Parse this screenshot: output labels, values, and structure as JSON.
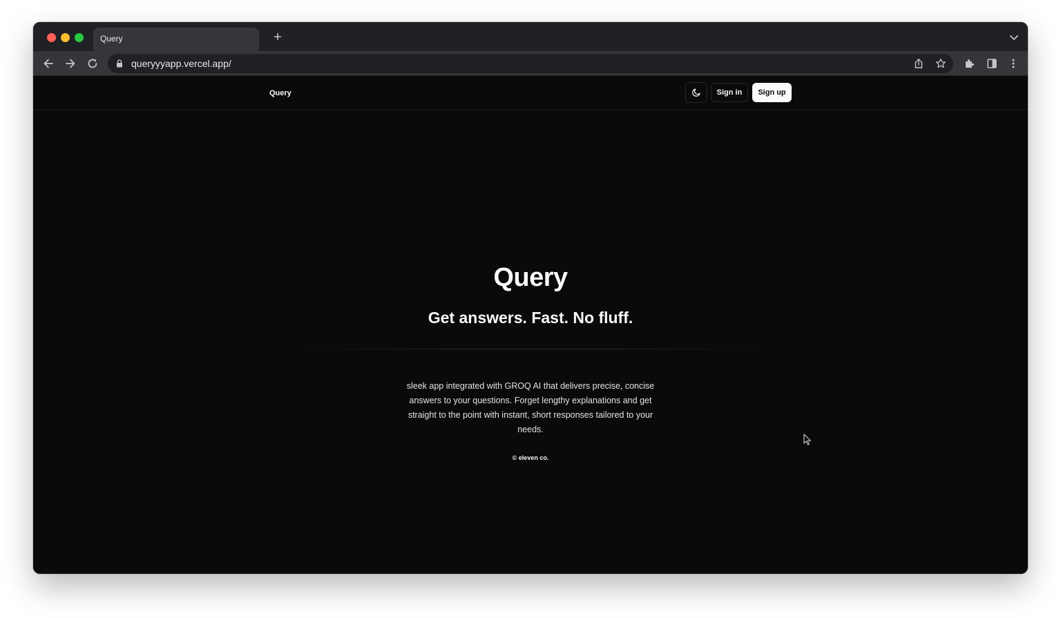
{
  "browser": {
    "tab_title": "Query",
    "new_tab_icon": "+",
    "url": "queryyyapp.vercel.app/"
  },
  "site": {
    "brand": "Query",
    "theme_toggle_icon": "moon-icon",
    "signin_label": "Sign in",
    "signup_label": "Sign up"
  },
  "hero": {
    "title": "Query",
    "subtitle": "Get answers. Fast. No fluff.",
    "description": "sleek app integrated with GROQ AI that delivers precise, concise answers to your questions. Forget lengthy explanations and get straight to the point with instant, short responses tailored to your needs.",
    "copyright": "© eleven co."
  },
  "colors": {
    "page_background": "#0a0a0a",
    "text_primary": "#fafafa",
    "button_primary_bg": "#fafafa",
    "border": "#27272a"
  }
}
